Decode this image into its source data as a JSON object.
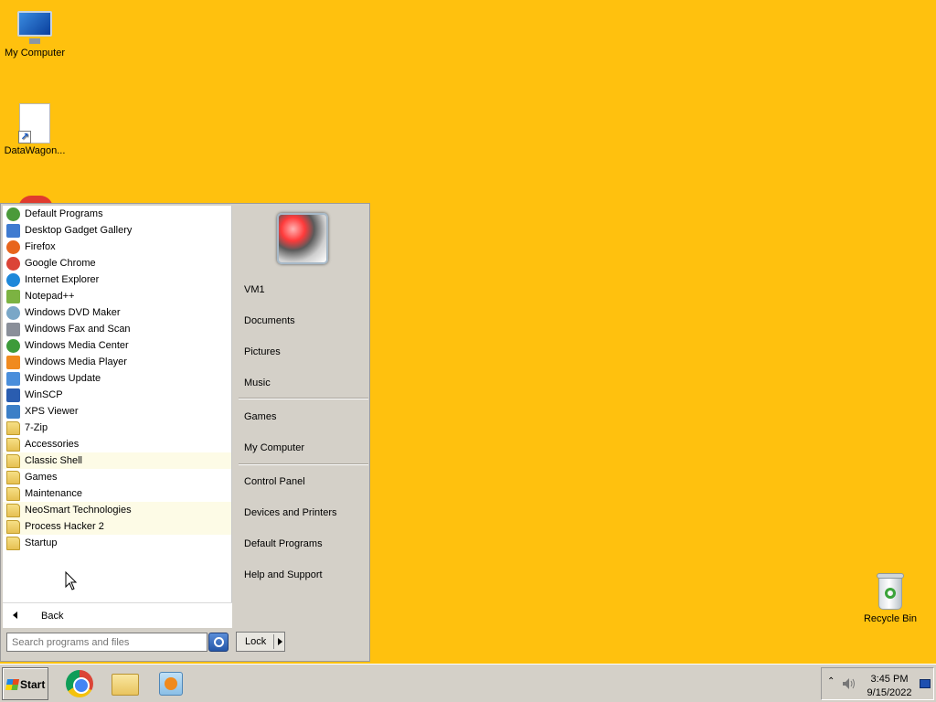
{
  "desktop": {
    "background_color": "#FFC10E",
    "icons": [
      {
        "label": "My Computer",
        "icon": "computer-icon"
      },
      {
        "label": "DataWagon...",
        "icon": "shortcut-file-icon"
      },
      {
        "label": "Recycle Bin",
        "icon": "recycle-bin-icon"
      }
    ]
  },
  "start_menu": {
    "programs": [
      {
        "label": "Default Programs",
        "icon": "default-programs-icon",
        "color": "#4b9a3a",
        "type": "round"
      },
      {
        "label": "Desktop Gadget Gallery",
        "icon": "gadget-gallery-icon",
        "color": "#3f7bd0",
        "type": "sq"
      },
      {
        "label": "Firefox",
        "icon": "firefox-icon",
        "color": "#e8651c",
        "type": "round"
      },
      {
        "label": "Google Chrome",
        "icon": "chrome-icon",
        "color": "#db4437",
        "type": "round"
      },
      {
        "label": "Internet Explorer",
        "icon": "ie-icon",
        "color": "#1e88d9",
        "type": "round"
      },
      {
        "label": "Notepad++",
        "icon": "notepadpp-icon",
        "color": "#7cb342",
        "type": "sq"
      },
      {
        "label": "Windows DVD Maker",
        "icon": "dvd-maker-icon",
        "color": "#7aa7c7",
        "type": "round"
      },
      {
        "label": "Windows Fax and Scan",
        "icon": "fax-scan-icon",
        "color": "#8a8f99",
        "type": "sq"
      },
      {
        "label": "Windows Media Center",
        "icon": "media-center-icon",
        "color": "#3d9b3a",
        "type": "round"
      },
      {
        "label": "Windows Media Player",
        "icon": "media-player-icon",
        "color": "#f08a1e",
        "type": "sq"
      },
      {
        "label": "Windows Update",
        "icon": "windows-update-icon",
        "color": "#4a8edb",
        "type": "sq"
      },
      {
        "label": "WinSCP",
        "icon": "winscp-icon",
        "color": "#2a5db0",
        "type": "sq"
      },
      {
        "label": "XPS Viewer",
        "icon": "xps-viewer-icon",
        "color": "#3c7fc7",
        "type": "sq"
      },
      {
        "label": "7-Zip",
        "icon": "folder-icon",
        "type": "folder"
      },
      {
        "label": "Accessories",
        "icon": "folder-icon",
        "type": "folder"
      },
      {
        "label": "Classic Shell",
        "icon": "folder-icon",
        "type": "folder",
        "highlight": true
      },
      {
        "label": "Games",
        "icon": "folder-icon",
        "type": "folder"
      },
      {
        "label": "Maintenance",
        "icon": "folder-icon",
        "type": "folder"
      },
      {
        "label": "NeoSmart Technologies",
        "icon": "folder-icon",
        "type": "folder",
        "highlight": true
      },
      {
        "label": "Process Hacker 2",
        "icon": "folder-icon",
        "type": "folder",
        "highlight": true
      },
      {
        "label": "Startup",
        "icon": "folder-icon",
        "type": "folder"
      }
    ],
    "back_label": "Back",
    "search": {
      "placeholder": "Search programs and files",
      "value": ""
    },
    "right_items": [
      {
        "label": "VM1"
      },
      {
        "label": "Documents"
      },
      {
        "label": "Pictures"
      },
      {
        "label": "Music"
      },
      {
        "label": "Games"
      },
      {
        "label": "My Computer"
      },
      {
        "label": "Control Panel"
      },
      {
        "label": "Devices and Printers"
      },
      {
        "label": "Default Programs"
      },
      {
        "label": "Help and Support"
      }
    ],
    "lock_label": "Lock"
  },
  "taskbar": {
    "start_label": "Start",
    "pinned": [
      {
        "name": "chrome-icon"
      },
      {
        "name": "file-explorer-icon"
      },
      {
        "name": "media-player-icon"
      }
    ],
    "tray": {
      "time": "3:45 PM",
      "date": "9/15/2022"
    }
  }
}
